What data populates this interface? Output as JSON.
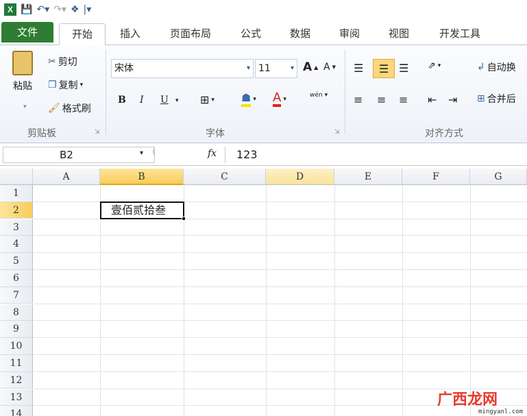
{
  "qat": {
    "excel_icon": "X",
    "save_icon": "save-icon",
    "undo_icon": "undo-icon",
    "redo_icon": "redo-icon",
    "customize_icon": "customize-icon"
  },
  "tabs": [
    "文件",
    "开始",
    "插入",
    "页面布局",
    "公式",
    "数据",
    "审阅",
    "视图",
    "开发工具"
  ],
  "ribbon": {
    "clipboard": {
      "paste": "粘贴",
      "cut": "剪切",
      "copy": "复制",
      "format_painter": "格式刷",
      "label": "剪贴板"
    },
    "font": {
      "name": "宋体",
      "size": "11",
      "bold": "B",
      "italic": "I",
      "underline": "U",
      "label": "字体",
      "grow": "A",
      "shrink": "A",
      "font_color": "A",
      "phonetic": "wén"
    },
    "align": {
      "wrap": "自动换",
      "merge": "合并后",
      "label": "对齐方式"
    }
  },
  "formula_bar": {
    "name_box": "B2",
    "fx": "fx",
    "value": "123"
  },
  "grid": {
    "columns": [
      "A",
      "B",
      "C",
      "D",
      "E",
      "F",
      "G"
    ],
    "rows": [
      "1",
      "2",
      "3",
      "4",
      "5",
      "6",
      "7",
      "8",
      "9",
      "10",
      "11",
      "12",
      "13",
      "14"
    ],
    "active_cell_value": "壹佰贰拾叁"
  },
  "watermark": {
    "text": "广西龙网",
    "url": "mingyanl.com"
  }
}
